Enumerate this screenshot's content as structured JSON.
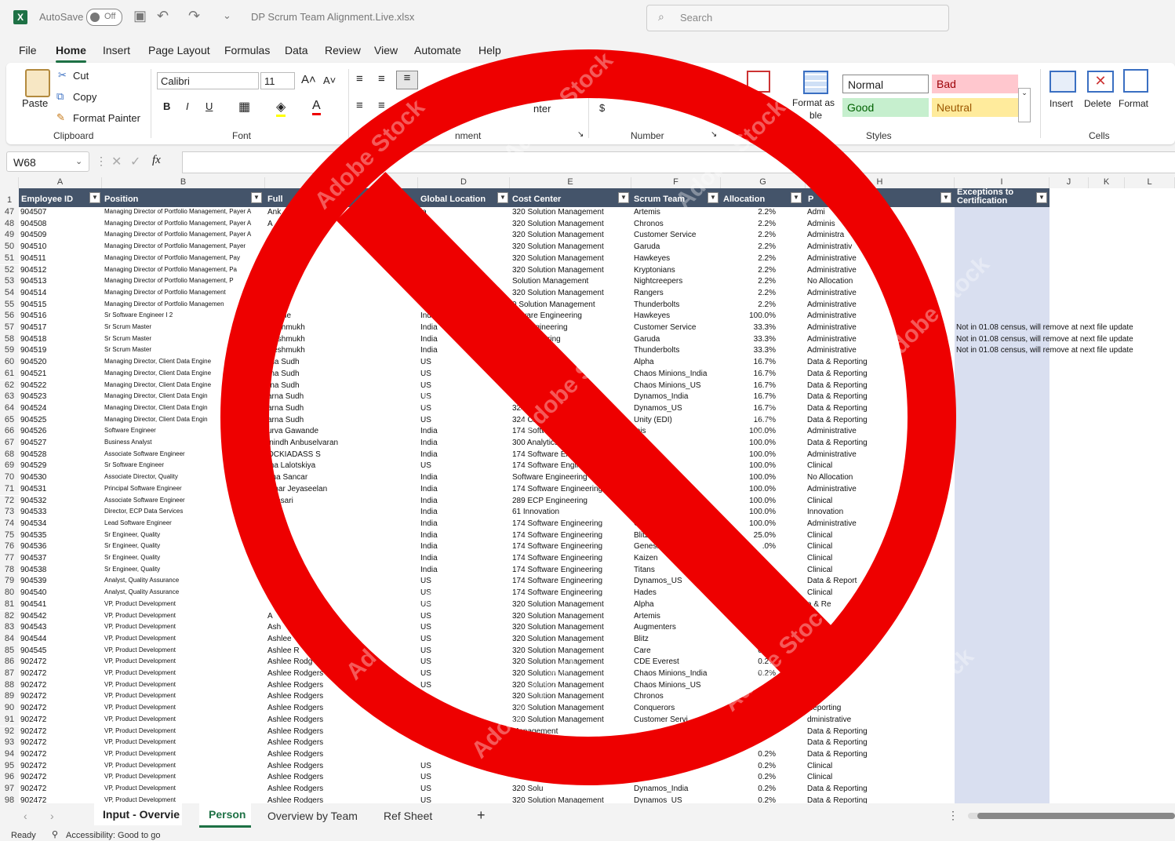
{
  "titlebar": {
    "autosave_label": "AutoSave",
    "autosave_state": "Off",
    "filename": "DP Scrum Team Alignment.Live.xlsx",
    "search_placeholder": "Search"
  },
  "menu": [
    "File",
    "Home",
    "Insert",
    "Page Layout",
    "Formulas",
    "Data",
    "Review",
    "View",
    "Automate",
    "Help"
  ],
  "ribbon": {
    "clipboard": {
      "label": "Clipboard",
      "paste": "Paste",
      "cut": "Cut",
      "copy": "Copy",
      "format_painter": "Format Painter"
    },
    "font": {
      "label": "Font",
      "name": "Calibri",
      "size": "11",
      "bold": "B",
      "italic": "I",
      "underline": "U"
    },
    "alignment": {
      "label_partial": "nment",
      "wrap_partial": "nter"
    },
    "number": {
      "label": "Number",
      "currency": "$"
    },
    "styles": {
      "label": "Styles",
      "format_as_table": "Format as",
      "format_as_table_2": "ble",
      "normal": "Normal",
      "bad": "Bad",
      "good": "Good",
      "neutral": "Neutral"
    },
    "cells": {
      "label": "Cells",
      "insert": "Insert",
      "delete": "Delete",
      "format": "Format"
    }
  },
  "formula_bar": {
    "name_box": "W68",
    "fx": "fx"
  },
  "columns": [
    "A",
    "B",
    "C",
    "D",
    "E",
    "F",
    "G",
    "H",
    "I",
    "J",
    "K",
    "L"
  ],
  "headers": {
    "employee_id": "Employee ID",
    "position": "Position",
    "full_name": "Full",
    "global_location": "Global Location",
    "cost_center": "Cost Center",
    "scrum_team": "Scrum Team",
    "allocation": "Allocation",
    "portfolio": "P",
    "exceptions_1": "Exceptions to",
    "exceptions_2": "Certification"
  },
  "header_row_number": "1",
  "rows": [
    [
      "47",
      "904507",
      "Managing Director of Portfolio Management, Payer A",
      "Ank",
      "ia",
      "320 Solution Management",
      "Artemis",
      "2.2%",
      "Admi",
      ""
    ],
    [
      "48",
      "904508",
      "Managing Director of Portfolio Management, Payer A",
      "A",
      "",
      "320 Solution Management",
      "Chronos",
      "2.2%",
      "Adminis",
      ""
    ],
    [
      "49",
      "904509",
      "Managing Director of Portfolio Management, Payer A",
      "",
      "",
      "320 Solution Management",
      "Customer Service",
      "2.2%",
      "Administra",
      ""
    ],
    [
      "50",
      "904510",
      "Managing Director of Portfolio Management, Payer",
      "",
      "",
      "320 Solution Management",
      "Garuda",
      "2.2%",
      "Administrativ",
      ""
    ],
    [
      "51",
      "904511",
      "Managing Director of Portfolio Management, Pay",
      "",
      "",
      "320 Solution Management",
      "Hawkeyes",
      "2.2%",
      "Administrative",
      ""
    ],
    [
      "52",
      "904512",
      "Managing Director of Portfolio Management, Pa",
      "",
      "",
      "320 Solution Management",
      "Kryptonians",
      "2.2%",
      "Administrative",
      ""
    ],
    [
      "53",
      "904513",
      "Managing Director of Portfolio Management, P",
      "",
      "",
      "Solution Management",
      "Nightcreepers",
      "2.2%",
      "No Allocation",
      ""
    ],
    [
      "54",
      "904514",
      "Managing Director of Portfolio Management",
      "",
      "",
      "320 Solution Management",
      "Rangers",
      "2.2%",
      "Administrative",
      ""
    ],
    [
      "55",
      "904515",
      "Managing Director of Portfolio Managemen",
      "pal",
      "India",
      "0 Solution Management",
      "Thunderbolts",
      "2.2%",
      "Administrative",
      ""
    ],
    [
      "56",
      "904516",
      "Sr Software Engineer I 2",
      "ibhane",
      "India",
      "oftware Engineering",
      "Hawkeyes",
      "100.0%",
      "Administrative",
      ""
    ],
    [
      "57",
      "904517",
      "Sr Scrum Master",
      "Deshmukh",
      "India",
      "are Engineering",
      "Customer Service",
      "33.3%",
      "Administrative",
      "Not in 01.08 census, will remove at next file update"
    ],
    [
      "58",
      "904518",
      "Sr Scrum Master",
      "Deshmukh",
      "India",
      "e Engineering",
      "Garuda",
      "33.3%",
      "Administrative",
      "Not in 01.08 census, will remove at next file update"
    ],
    [
      "59",
      "904519",
      "Sr Scrum Master",
      "Deshmukh",
      "India",
      "ineering",
      "Thunderbolts",
      "33.3%",
      "Administrative",
      "Not in 01.08 census, will remove at next file update"
    ],
    [
      "60",
      "904520",
      "Managing Director, Client Data Engine",
      "rna Sudh",
      "US",
      "eering",
      "Alpha",
      "16.7%",
      "Data & Reporting",
      ""
    ],
    [
      "61",
      "904521",
      "Managing Director, Client Data Engine",
      "rna Sudh",
      "US",
      "ring",
      "Chaos Minions_India",
      "16.7%",
      "Data & Reporting",
      ""
    ],
    [
      "62",
      "904522",
      "Managing Director, Client Data Engine",
      "rna Sudh",
      "US",
      "",
      "Chaos Minions_US",
      "16.7%",
      "Data & Reporting",
      ""
    ],
    [
      "63",
      "904523",
      "Managing Director, Client Data Engin",
      "arna Sudh",
      "US",
      "",
      "Dynamos_India",
      "16.7%",
      "Data & Reporting",
      ""
    ],
    [
      "64",
      "904524",
      "Managing Director, Client Data Engin",
      "arna Sudh",
      "US",
      "324 Cli",
      "Dynamos_US",
      "16.7%",
      "Data & Reporting",
      ""
    ],
    [
      "65",
      "904525",
      "Managing Director, Client Data Engin",
      "arna Sudh",
      "US",
      "324 Client",
      "Unity (EDI)",
      "16.7%",
      "Data & Reporting",
      ""
    ],
    [
      "66",
      "904526",
      "Software Engineer",
      "urva Gawande",
      "India",
      "174 Software E",
      "mis",
      "100.0%",
      "Administrative",
      ""
    ],
    [
      "67",
      "904527",
      "Business Analyst",
      "inindh Anbuselvaran",
      "India",
      "300 Analytics",
      "ers",
      "100.0%",
      "Data & Reporting",
      ""
    ],
    [
      "68",
      "904528",
      "Associate Software Engineer",
      "OCKIADASS S",
      "India",
      "174 Software Enginee",
      "",
      "100.0%",
      "Administrative",
      ""
    ],
    [
      "69",
      "904529",
      "Sr Software Engineer",
      "ma Lalotskiya",
      "US",
      "174 Software Engineering",
      "",
      "100.0%",
      "Clinical",
      ""
    ],
    [
      "70",
      "904530",
      "Associate Director, Quality",
      "dha Sancar",
      "India",
      "Software Engineering",
      "",
      "100.0%",
      "No Allocation",
      ""
    ],
    [
      "71",
      "904531",
      "Principal Software Engineer",
      "umar Jeyaseelan",
      "India",
      "174 Software Engineering",
      "",
      "100.0%",
      "Administrative",
      ""
    ],
    [
      "72",
      "904532",
      "Associate Software Engineer",
      "i Ansari",
      "India",
      "289 ECP Engineering",
      "",
      "100.0%",
      "Clinical",
      ""
    ],
    [
      "73",
      "904533",
      "Director, ECP Data Services",
      "are",
      "India",
      "61 Innovation",
      "D",
      "100.0%",
      "Innovation",
      ""
    ],
    [
      "74",
      "904534",
      "Lead Software Engineer",
      "ar",
      "India",
      "174 Software Engineering",
      "Garud",
      "100.0%",
      "Administrative",
      ""
    ],
    [
      "75",
      "904535",
      "Sr Engineer, Quality",
      "",
      "India",
      "174 Software Engineering",
      "Blitz",
      "25.0%",
      "Clinical",
      ""
    ],
    [
      "76",
      "904536",
      "Sr Engineer, Quality",
      "",
      "India",
      "174 Software Engineering",
      "Genesis",
      ".0%",
      "Clinical",
      ""
    ],
    [
      "77",
      "904537",
      "Sr Engineer, Quality",
      "",
      "India",
      "174 Software Engineering",
      "Kaizen",
      "",
      "Clinical",
      ""
    ],
    [
      "78",
      "904538",
      "Sr Engineer, Quality",
      "",
      "India",
      "174 Software Engineering",
      "Titans",
      "",
      "Clinical",
      ""
    ],
    [
      "79",
      "904539",
      "Analyst, Quality Assurance",
      "",
      "US",
      "174 Software Engineering",
      "Dynamos_US",
      "",
      "Data & Report",
      ""
    ],
    [
      "80",
      "904540",
      "Analyst, Quality Assurance",
      "",
      "US",
      "174 Software Engineering",
      "Hades",
      "",
      "Clinical",
      ""
    ],
    [
      "81",
      "904541",
      "VP, Product Development",
      "",
      "US",
      "320 Solution Management",
      "Alpha",
      "",
      "a & Re",
      ""
    ],
    [
      "82",
      "904542",
      "VP, Product Development",
      "A",
      "US",
      "320 Solution Management",
      "Artemis",
      "",
      "",
      ""
    ],
    [
      "83",
      "904543",
      "VP, Product Development",
      "Ash",
      "US",
      "320 Solution Management",
      "Augmenters",
      "0.",
      "",
      ""
    ],
    [
      "84",
      "904544",
      "VP, Product Development",
      "Ashlee",
      "US",
      "320 Solution Management",
      "Blitz",
      "0.2%",
      "",
      ""
    ],
    [
      "85",
      "904545",
      "VP, Product Development",
      "Ashlee R",
      "US",
      "320 Solution Management",
      "Care",
      "0.2%",
      "",
      ""
    ],
    [
      "86",
      "902472",
      "VP, Product Development",
      "Ashlee Rodg",
      "US",
      "320 Solution Management",
      "CDE Everest",
      "0.2%",
      "",
      ""
    ],
    [
      "87",
      "902472",
      "VP, Product Development",
      "Ashlee Rodgers",
      "US",
      "320 Solution Management",
      "Chaos Minions_India",
      "0.2%",
      "ng",
      ""
    ],
    [
      "88",
      "902472",
      "VP, Product Development",
      "Ashlee Rodgers",
      "US",
      "320 Solution Management",
      "Chaos Minions_US",
      "0",
      "rting",
      ""
    ],
    [
      "89",
      "902472",
      "VP, Product Development",
      "Ashlee Rodgers",
      "",
      "320 Solution Management",
      "Chronos",
      "",
      "ative",
      ""
    ],
    [
      "90",
      "902472",
      "VP, Product Development",
      "Ashlee Rodgers",
      "",
      "320 Solution Management",
      "Conquerors",
      "",
      "Reporting",
      ""
    ],
    [
      "91",
      "902472",
      "VP, Product Development",
      "Ashlee Rodgers",
      "",
      "320 Solution Management",
      "Customer Servi",
      "",
      "dministrative",
      ""
    ],
    [
      "92",
      "902472",
      "VP, Product Development",
      "Ashlee Rodgers",
      "",
      "Management",
      "",
      "",
      "Data & Reporting",
      ""
    ],
    [
      "93",
      "902472",
      "VP, Product Development",
      "Ashlee Rodgers",
      "",
      "",
      "",
      "",
      "Data & Reporting",
      ""
    ],
    [
      "94",
      "902472",
      "VP, Product Development",
      "Ashlee Rodgers",
      "",
      "",
      "",
      "0.2%",
      "Data & Reporting",
      ""
    ],
    [
      "95",
      "902472",
      "VP, Product Development",
      "Ashlee Rodgers",
      "US",
      "",
      "",
      "0.2%",
      "Clinical",
      ""
    ],
    [
      "96",
      "902472",
      "VP, Product Development",
      "Ashlee Rodgers",
      "US",
      "",
      "",
      "0.2%",
      "Clinical",
      ""
    ],
    [
      "97",
      "902472",
      "VP, Product Development",
      "Ashlee Rodgers",
      "US",
      "320 Solu",
      "Dynamos_India",
      "0.2%",
      "Data & Reporting",
      ""
    ],
    [
      "98",
      "902472",
      "VP, Product Development",
      "Ashlee Rodgers",
      "US",
      "320 Solution Management",
      "Dynamos_US",
      "0.2%",
      "Data & Reporting",
      ""
    ]
  ],
  "sheet_tabs": [
    "Input - Overvie",
    "Person",
    "Overview by Team",
    "Ref Sheet"
  ],
  "add_sheet": "+",
  "status": {
    "ready": "Ready",
    "accessibility": "Accessibility: Good to go"
  },
  "watermark": "Adobe Stock",
  "colors": {
    "prohibition_red": "#ee0000",
    "header_fill": "#44546a",
    "exceptions_fill": "#d9dff0",
    "excel_green": "#1e7145"
  }
}
